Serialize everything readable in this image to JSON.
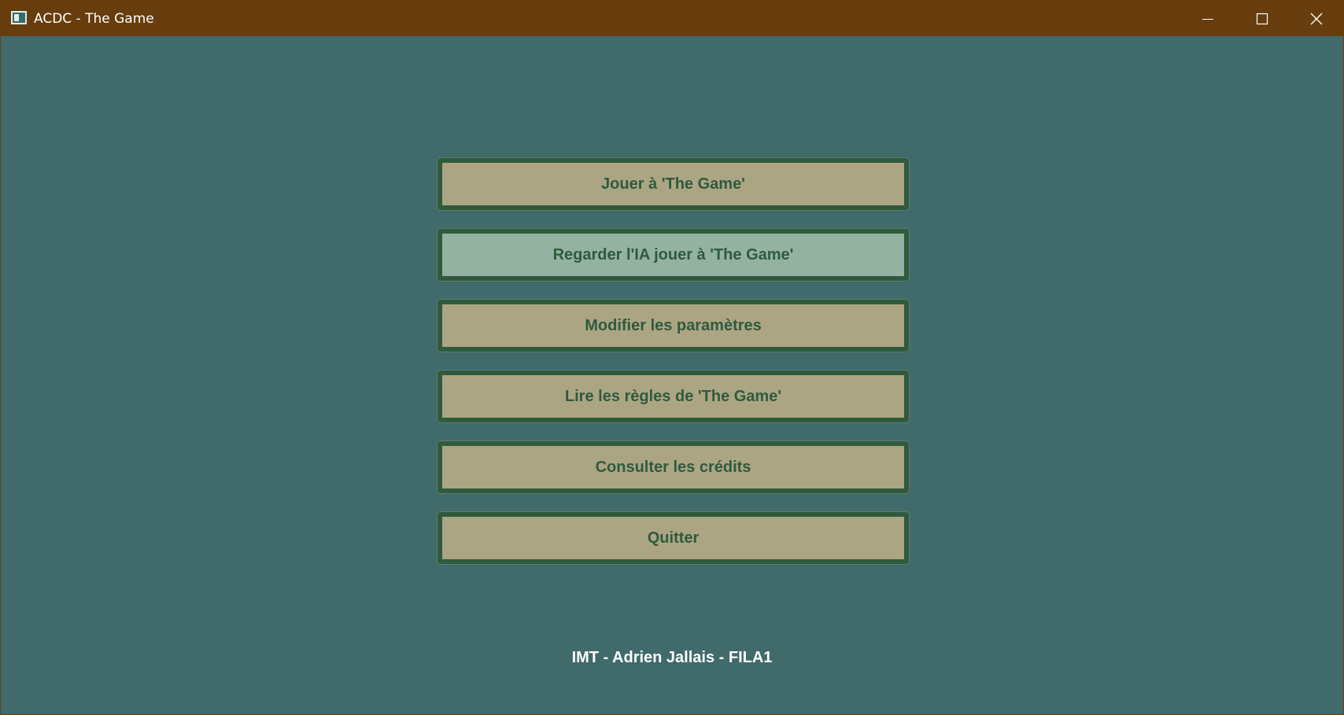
{
  "window": {
    "title": "ACDC - The Game",
    "icon": "app-window-icon",
    "controls": {
      "minimize": "minimize-icon",
      "maximize": "maximize-icon",
      "close": "close-icon"
    }
  },
  "menu": {
    "items": [
      {
        "label": "Jouer à 'The Game'",
        "state": "normal"
      },
      {
        "label": "Regarder l'IA jouer à 'The Game'",
        "state": "hover"
      },
      {
        "label": "Modifier les paramètres",
        "state": "normal"
      },
      {
        "label": "Lire les règles de 'The Game'",
        "state": "normal"
      },
      {
        "label": "Consulter les crédits",
        "state": "normal"
      },
      {
        "label": "Quitter",
        "state": "normal"
      }
    ]
  },
  "footer": {
    "text": "IMT - Adrien Jallais - FILA1"
  },
  "colors": {
    "titlebar": "#673d0e",
    "background": "#416a6a",
    "button": "#aca583",
    "button_hover": "#94b2a1",
    "button_border": "#2f5a3e",
    "button_text": "#2f5a3e",
    "footer_text": "#ffffff"
  }
}
